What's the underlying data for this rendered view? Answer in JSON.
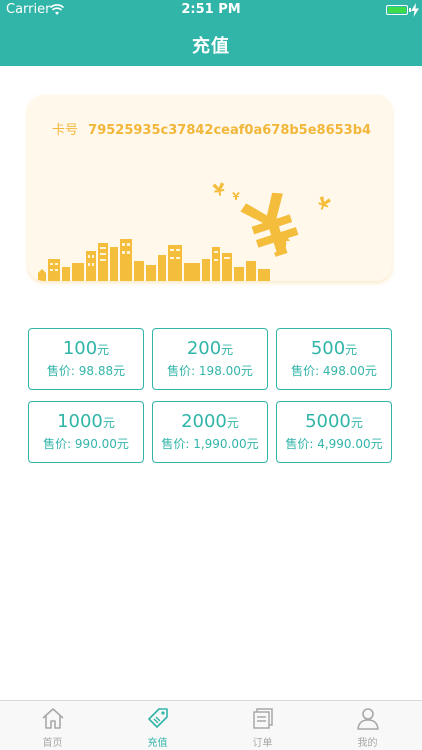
{
  "status_bar": {
    "carrier": "Carrier",
    "time": "2:51 PM",
    "icons": [
      "wifi-icon",
      "battery-icon",
      "charging-icon"
    ]
  },
  "header": {
    "title": "充值"
  },
  "card": {
    "label": "卡号",
    "number": "79525935c37842ceaf0a678b5e8653b4",
    "illustration": [
      "yen-coin-icon",
      "city-skyline-icon"
    ]
  },
  "options": [
    {
      "amount": "100",
      "unit": "元",
      "price": "售价: 98.88元"
    },
    {
      "amount": "200",
      "unit": "元",
      "price": "售价: 198.00元"
    },
    {
      "amount": "500",
      "unit": "元",
      "price": "售价: 498.00元"
    },
    {
      "amount": "1000",
      "unit": "元",
      "price": "售价: 990.00元"
    },
    {
      "amount": "2000",
      "unit": "元",
      "price": "售价: 1,990.00元"
    },
    {
      "amount": "5000",
      "unit": "元",
      "price": "售价: 4,990.00元"
    }
  ],
  "tabbar": {
    "items": [
      {
        "label": "首页",
        "icon": "home-icon",
        "active": false
      },
      {
        "label": "充值",
        "icon": "tag-icon",
        "active": true
      },
      {
        "label": "订单",
        "icon": "orders-icon",
        "active": false
      },
      {
        "label": "我的",
        "icon": "profile-icon",
        "active": false
      }
    ]
  },
  "colors": {
    "accent": "#32b5a9",
    "card_bg": "#fff8eb",
    "card_text": "#f2b73a",
    "tab_inactive": "#a8a8a8"
  }
}
